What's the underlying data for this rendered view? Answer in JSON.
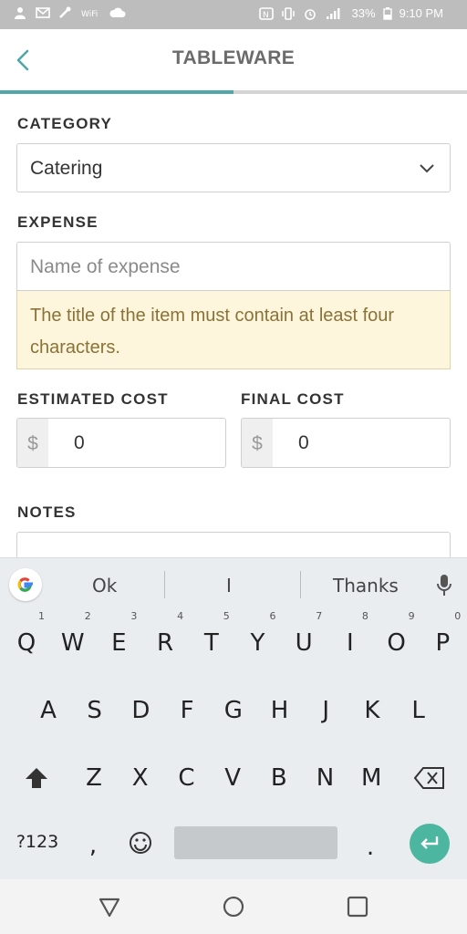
{
  "status_bar": {
    "battery": "33%",
    "time": "9:10 PM",
    "left_icons": [
      "person-icon",
      "mail-icon",
      "tools-icon",
      "wifi-calling-icon",
      "cloud-icon"
    ],
    "right_icons": [
      "nfc-icon",
      "vibrate-icon",
      "alarm-icon",
      "signal-icon",
      "battery-icon"
    ]
  },
  "header": {
    "title": "TABLEWARE",
    "progress": 0.5
  },
  "form": {
    "category_label": "CATEGORY",
    "category_value": "Catering",
    "expense_label": "EXPENSE",
    "expense_placeholder": "Name of expense",
    "expense_warning": "The title of the item must contain at least four characters.",
    "estimated_cost_label": "ESTIMATED COST",
    "estimated_cost_currency": "$",
    "estimated_cost_value": "0",
    "final_cost_label": "FINAL COST",
    "final_cost_currency": "$",
    "final_cost_value": "0",
    "notes_label": "NOTES"
  },
  "keyboard": {
    "suggestions": [
      "Ok",
      "I",
      "Thanks"
    ],
    "row1": [
      {
        "key": "Q",
        "hint": "1"
      },
      {
        "key": "W",
        "hint": "2"
      },
      {
        "key": "E",
        "hint": "3"
      },
      {
        "key": "R",
        "hint": "4"
      },
      {
        "key": "T",
        "hint": "5"
      },
      {
        "key": "Y",
        "hint": "6"
      },
      {
        "key": "U",
        "hint": "7"
      },
      {
        "key": "I",
        "hint": "8"
      },
      {
        "key": "O",
        "hint": "9"
      },
      {
        "key": "P",
        "hint": "0"
      }
    ],
    "row2": [
      "A",
      "S",
      "D",
      "F",
      "G",
      "H",
      "J",
      "K",
      "L"
    ],
    "row3": [
      "Z",
      "X",
      "C",
      "V",
      "B",
      "N",
      "M"
    ],
    "symbols_label": "?123",
    "comma": ",",
    "period": ".",
    "accent_color": "#4db6a0"
  },
  "colors": {
    "accent": "#4fa7a7",
    "warning_bg": "#fdf6dc",
    "warning_text": "#8a7238"
  }
}
